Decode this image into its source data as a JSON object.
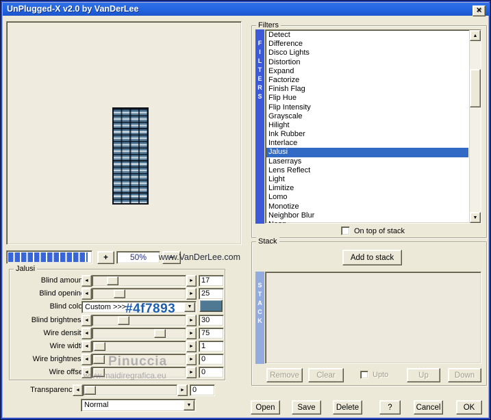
{
  "window": {
    "title": "UnPlugged-X v2.0 by VanDerLee"
  },
  "glyphs": {
    "close": "✕",
    "plus": "+",
    "minus": "−",
    "arrow_up": "▲",
    "arrow_down": "▼",
    "arrow_left": "◄",
    "arrow_right": "►",
    "dropdown": "▼"
  },
  "preview": {
    "zoom_value": "50%",
    "website": "www.VanDerLee.com"
  },
  "filters": {
    "group_label": "Filters",
    "side_label": "FILTERS",
    "items": [
      "Detect",
      "Difference",
      "Disco Lights",
      "Distortion",
      "Expand",
      "Factorize",
      "Finish Flag",
      "Flip Hue",
      "Flip Intensity",
      "Grayscale",
      "Hilight",
      "Ink Rubber",
      "Interlace",
      "Jalusi",
      "Laserrays",
      "Lens Reflect",
      "Light",
      "Limitize",
      "Lomo",
      "Monotize",
      "Neighbor Blur",
      "Neon"
    ],
    "selected": "Jalusi",
    "on_top_label": "On top of stack"
  },
  "stack": {
    "group_label": "Stack",
    "side_label": "STACK",
    "add_button": "Add to stack",
    "remove_button": "Remove",
    "clear_button": "Clear",
    "upto_label": "Upto",
    "up_button": "Up",
    "down_button": "Down"
  },
  "actions": {
    "open": "Open",
    "save": "Save",
    "delete": "Delete",
    "help": "?",
    "cancel": "Cancel",
    "ok": "OK"
  },
  "jalusi": {
    "group_label": "Jalusi",
    "rows": [
      {
        "type": "slider",
        "label": "Blind amount",
        "value": "17",
        "pct": 17
      },
      {
        "type": "slider",
        "label": "Blind opening",
        "value": "25",
        "pct": 25
      },
      {
        "type": "color",
        "label": "Blind color",
        "dropdown_value": "Custom >>>",
        "swatch_hex": "#4f7893"
      },
      {
        "type": "slider",
        "label": "Blind brightness",
        "value": "30",
        "pct": 30
      },
      {
        "type": "slider",
        "label": "Wire density",
        "value": "75",
        "pct": 75
      },
      {
        "type": "slider",
        "label": "Wire width",
        "value": "1",
        "pct": 1
      },
      {
        "type": "slider",
        "label": "Wire brightness",
        "value": "0",
        "pct": 0
      },
      {
        "type": "slider",
        "label": "Wire offset",
        "value": "0",
        "pct": 0
      }
    ],
    "transparency": {
      "label": "Transparency",
      "value": "0",
      "pct": 0,
      "blend_mode": "Normal"
    }
  },
  "annotations": {
    "color_hex": "#4f7893",
    "watermark_name": "Pinuccia",
    "watermark_site": "www.maidiregrafica.eu"
  },
  "colors": {
    "titlebar_blue": "#2264e0",
    "highlight_blue": "#316ac5",
    "filters_bar_blue": "#3c5ad8",
    "stack_bar_blue": "#93abdf",
    "progress_blue": "#3866d9",
    "swatch": "#4f7893",
    "dialog_bg": "#ece9d8"
  }
}
